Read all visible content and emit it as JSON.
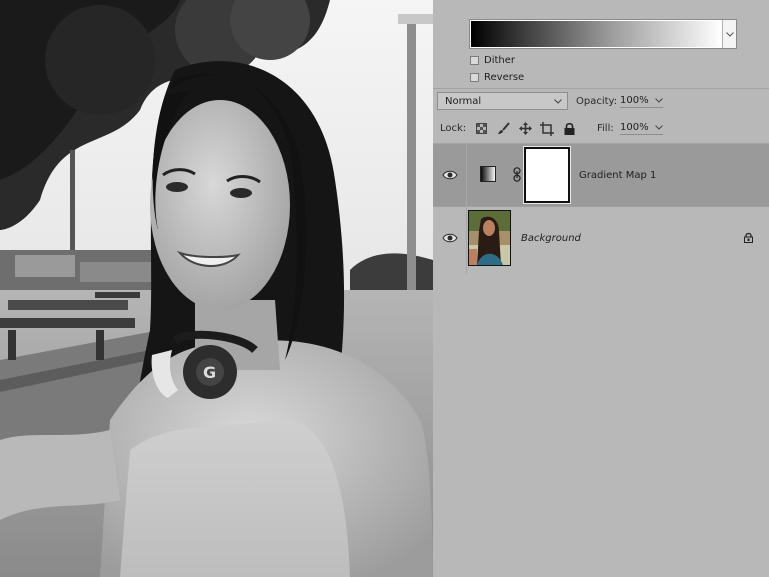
{
  "gradient_editor": {
    "dither_label": "Dither",
    "reverse_label": "Reverse",
    "dither_checked": false,
    "reverse_checked": false
  },
  "layers_panel": {
    "blend_mode": "Normal",
    "opacity_label": "Opacity:",
    "opacity_value": "100%",
    "lock_label": "Lock:",
    "fill_label": "Fill:",
    "fill_value": "100%",
    "layers": [
      {
        "name": "Gradient Map 1",
        "type": "adjustment",
        "visible": true,
        "selected": true
      },
      {
        "name": "Background",
        "type": "pixel",
        "visible": true,
        "selected": false,
        "locked": true
      }
    ]
  },
  "colors": {
    "panel_bg": "#b8b8b8",
    "selected_layer_bg": "#9a9a9a"
  }
}
